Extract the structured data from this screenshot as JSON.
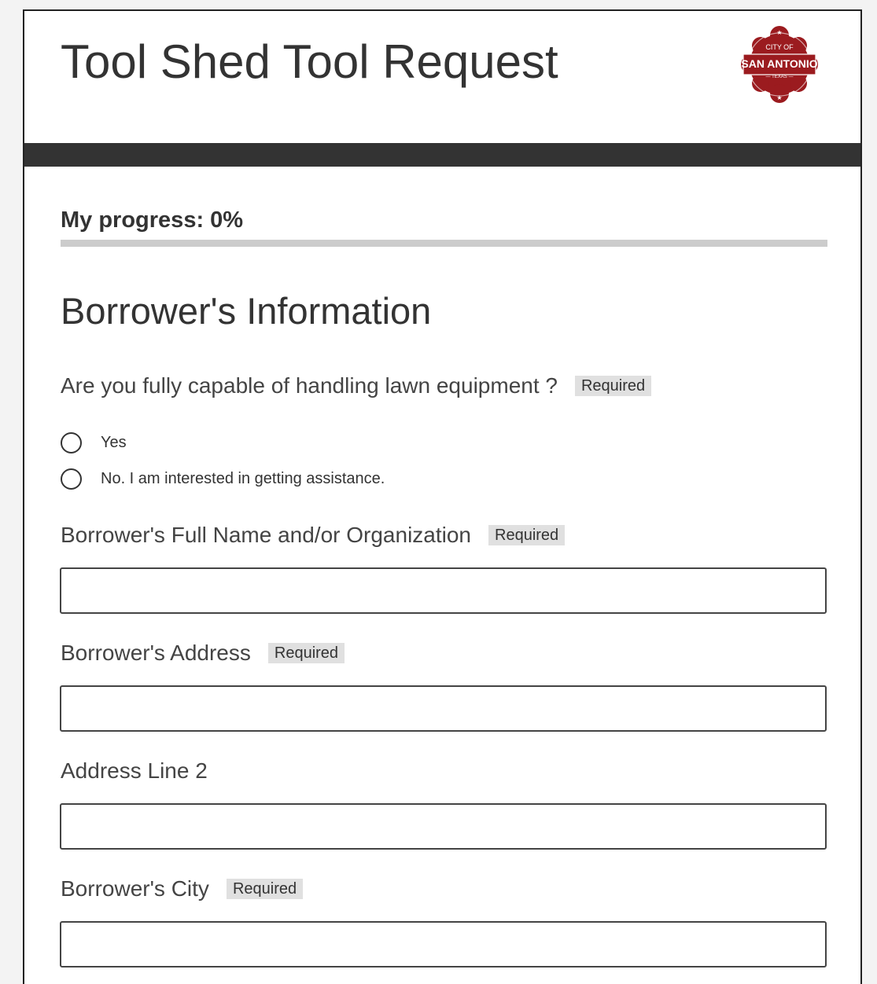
{
  "header": {
    "title": "Tool Shed Tool Request",
    "logo": {
      "icon": "city-of-san-antonio-seal",
      "top_text": "CITY OF",
      "main_text": "SAN ANTONIO",
      "bottom_text": "— TEXAS —",
      "color": "#9b1b1f"
    }
  },
  "progress": {
    "label": "My progress: 0%",
    "value": 0
  },
  "section": {
    "title": "Borrower's Information"
  },
  "fields": {
    "lawn_capability": {
      "question": "Are you fully capable of handling lawn equipment ?",
      "required_label": "Required",
      "options": [
        {
          "label": "Yes",
          "selected": false
        },
        {
          "label": "No. I am interested in getting assistance.",
          "selected": false
        }
      ]
    },
    "full_name": {
      "label": "Borrower's Full Name and/or Organization",
      "required_label": "Required",
      "value": ""
    },
    "address": {
      "label": "Borrower's Address",
      "required_label": "Required",
      "value": ""
    },
    "address_line2": {
      "label": "Address Line 2",
      "value": ""
    },
    "city": {
      "label": "Borrower's City",
      "required_label": "Required",
      "value": ""
    }
  },
  "colors": {
    "header_band": "#333333",
    "progress_track": "#cccccc",
    "badge_background": "#e0e0e0",
    "logo_red": "#9b1b1f"
  }
}
